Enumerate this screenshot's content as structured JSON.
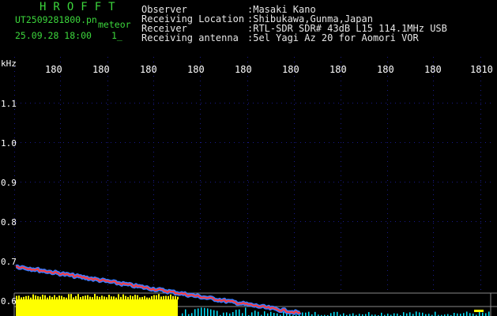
{
  "header": {
    "brand": "HROFFT",
    "filename": "UT2509281800.pn",
    "type_label": "meteor",
    "datetime": "25.09.28 18:00",
    "index": "1_"
  },
  "metadata": [
    {
      "label": "Observer",
      "value": ":Masaki Kano"
    },
    {
      "label": "Receiving Location",
      "value": ":Shibukawa,Gunma,Japan"
    },
    {
      "label": "Receiver",
      "value": ":RTL-SDR SDR# 43dB L15 114.1MHz USB"
    },
    {
      "label": "Receiving antenna",
      "value": ":5el Yagi Az 20 for Aomori VOR"
    }
  ],
  "spectrogram": {
    "y_unit": "kHz",
    "y_ticks": [
      "1.1",
      "1.0",
      "0.9",
      "0.8",
      "0.7",
      "0.6"
    ],
    "x_ticks": [
      "180",
      "180",
      "180",
      "180",
      "180",
      "180",
      "180",
      "180",
      "180",
      "1810"
    ],
    "colors": {
      "background": "#000000",
      "grid_dots": "#1a1a8a",
      "tick_labels": "#ffffff",
      "signal_core": "#ff3b3b",
      "signal_edge": "#3a7bff",
      "noise_band": "#ffff00",
      "noise_cyan": "#00e5ff"
    }
  }
}
